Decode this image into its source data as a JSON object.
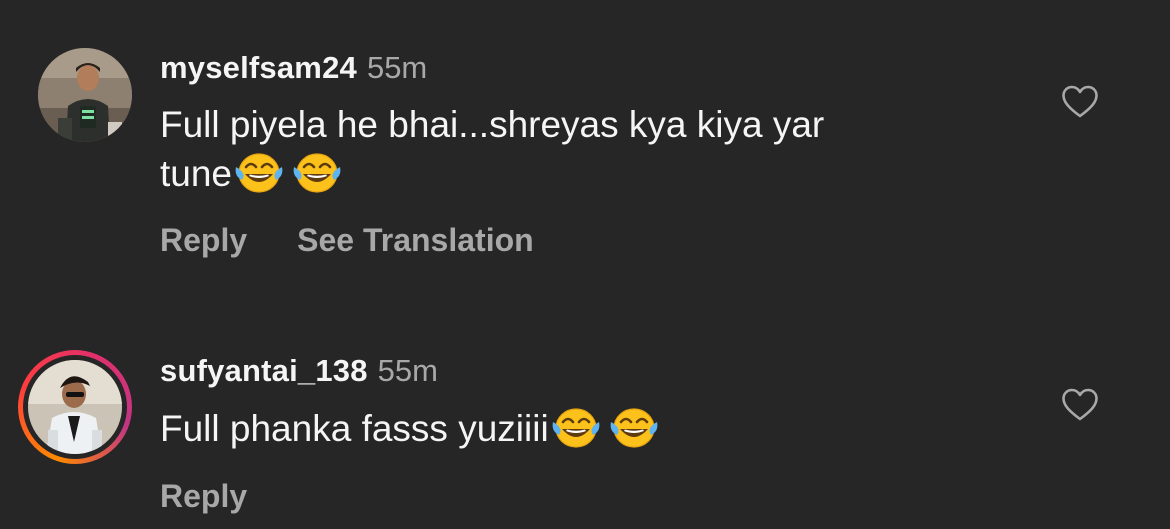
{
  "comments": [
    {
      "username": "myselfsam24",
      "time": "55m",
      "text_line1": "Full piyela he bhai...shreyas kya kiya yar",
      "text_line2": "tune",
      "emojis": [
        "tears-of-joy",
        "tears-of-joy"
      ],
      "reply_label": "Reply",
      "translation_label": "See Translation",
      "has_story_ring": false
    },
    {
      "username": "sufyantai_138",
      "time": "55m",
      "text_line1": "Full phanka fasss yuziiii",
      "emojis": [
        "tears-of-joy",
        "tears-of-joy"
      ],
      "reply_label": "Reply",
      "has_story_ring": true
    }
  ],
  "colors": {
    "background": "#262626",
    "primary_text": "#f5f5f5",
    "secondary_text": "#a8a8a8",
    "story_ring": [
      "#ff8a00",
      "#e1306c",
      "#c13584"
    ]
  },
  "icons": {
    "like": "heart-outline-icon",
    "emoji": "face-with-tears-of-joy"
  }
}
